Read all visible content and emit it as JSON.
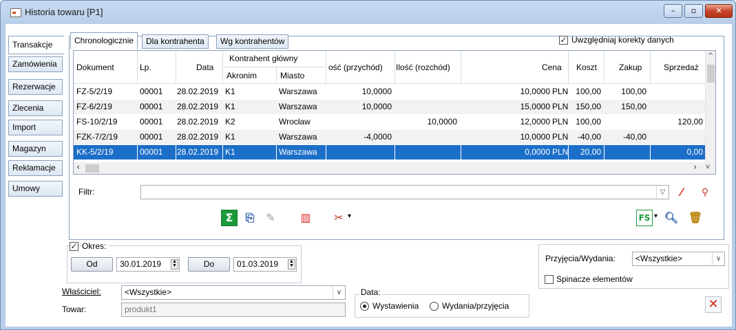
{
  "window": {
    "title": "Historia towaru [P1]",
    "min": "–",
    "max": "▫",
    "close": "✕"
  },
  "left_tabs": [
    "Transakcje",
    "Zamówienia",
    "Rezerwacje",
    "Zlecenia",
    "Import",
    "Magazyn",
    "Reklamacje",
    "Umowy"
  ],
  "top_tabs": [
    "Chronologicznie",
    "Dla kontrahenta",
    "Wg kontrahentów"
  ],
  "korekty": {
    "label": "Uwzględniaj korekty danych",
    "checked": true
  },
  "grid": {
    "headers": {
      "dokument": "Dokument",
      "lp": "Lp.",
      "data": "Data",
      "kontrahent_group": "Kontrahent główny",
      "akronim": "Akronim",
      "miasto": "Miasto",
      "przychod": "ość (przychód)",
      "rozchod": "Ilość (rozchód)",
      "cena": "Cena",
      "koszt": "Koszt",
      "zakup": "Zakup",
      "sprzedaz": "Sprzedaż"
    },
    "rows": [
      {
        "dokument": "FZ-5/2/19",
        "lp": "00001",
        "data": "28.02.2019",
        "akronim": "K1",
        "miasto": "Warszawa",
        "przychod": "10,0000",
        "rozchod": "",
        "cena": "10,0000",
        "waluta": "PLN",
        "koszt": "100,00",
        "zakup": "100,00",
        "sprzedaz": ""
      },
      {
        "dokument": "FZ-6/2/19",
        "lp": "00001",
        "data": "28.02.2019",
        "akronim": "K1",
        "miasto": "Warszawa",
        "przychod": "10,0000",
        "rozchod": "",
        "cena": "15,0000",
        "waluta": "PLN",
        "koszt": "150,00",
        "zakup": "150,00",
        "sprzedaz": ""
      },
      {
        "dokument": "FS-10/2/19",
        "lp": "00001",
        "data": "28.02.2019",
        "akronim": "K2",
        "miasto": "Wrocław",
        "przychod": "",
        "rozchod": "10,0000",
        "cena": "12,0000",
        "waluta": "PLN",
        "koszt": "100,00",
        "zakup": "",
        "sprzedaz": "120,00"
      },
      {
        "dokument": "FZK-7/2/19",
        "lp": "00001",
        "data": "28.02.2019",
        "akronim": "K1",
        "miasto": "Warszawa",
        "przychod": "-4,0000",
        "rozchod": "",
        "cena": "10,0000",
        "waluta": "PLN",
        "koszt": "-40,00",
        "zakup": "-40,00",
        "sprzedaz": ""
      },
      {
        "dokument": "KK-5/2/19",
        "lp": "00001",
        "data": "28.02.2019",
        "akronim": "K1",
        "miasto": "Warszawa",
        "przychod": "",
        "rozchod": "",
        "cena": "0,0000",
        "waluta": "PLN",
        "koszt": "20,00",
        "zakup": "",
        "sprzedaz": "0,00"
      }
    ],
    "selected_row": 4
  },
  "filter": {
    "label": "Filtr:",
    "value": ""
  },
  "toolbar_icons": [
    "sum-icon",
    "export-icon",
    "edit-icon",
    "columns-icon",
    "document-tools-icon",
    "fs-icon",
    "search-icon",
    "delete-icon"
  ],
  "okres": {
    "label": "Okres:",
    "checked": true,
    "od_label": "Od",
    "od_value": "30.01.2019",
    "do_label": "Do",
    "do_value": "01.03.2019"
  },
  "przyjecia": {
    "label": "Przyjęcia/Wydania:",
    "value": "<Wszystkie>"
  },
  "spinacze": {
    "label": "Spinacze elementów",
    "checked": false
  },
  "wlasciciel": {
    "label": "Właściciel:",
    "value": "<Wszystkie>"
  },
  "towar": {
    "label": "Towar:",
    "value": "produkt1"
  },
  "data_radio": {
    "label": "Data:",
    "option1": "Wystawienia",
    "option2": "Wydania/przyjęcia",
    "selected": "Wystawienia"
  },
  "colors": {
    "selection": "#1c6fc8",
    "accent_red": "#d9261c",
    "accent_green": "#1a9a3a"
  }
}
